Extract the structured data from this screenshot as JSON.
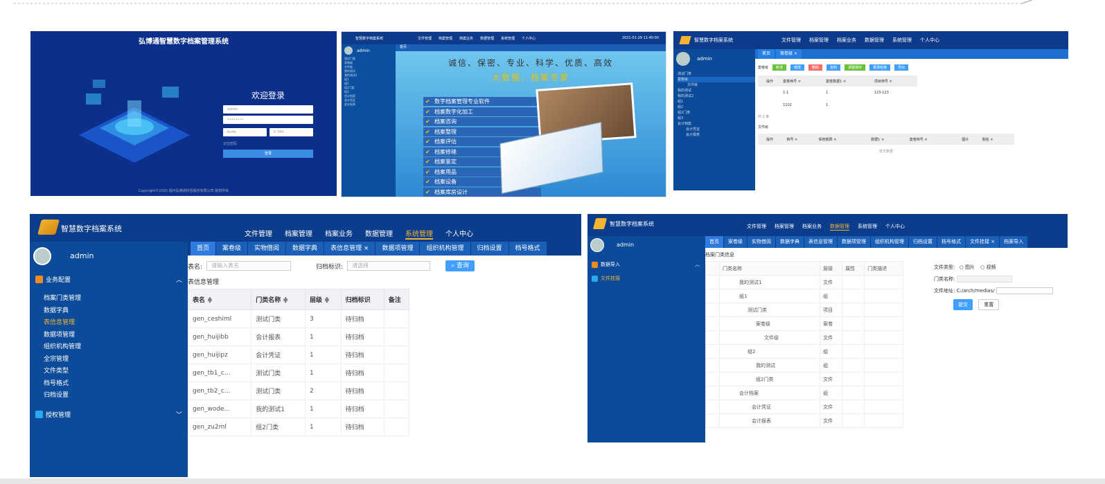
{
  "panel1": {
    "title": "弘博通智慧数字档案管理系统",
    "welcome": "欢迎登录",
    "username": "admin",
    "password": "••••••••",
    "captcha_input": "bx4e",
    "captcha_img": "6 ₰ϑ4",
    "remember": "记住密码",
    "login_button": "登录",
    "footer": "Copyright©2020 福州弘博通科技股份有限公司 版权所有"
  },
  "panel2": {
    "brand": "智慧数字档案系统",
    "nav": [
      "文件管理",
      "档案管理",
      "档案业务",
      "数据管理",
      "系统管理",
      "个人中心"
    ],
    "datetime": "2021-01-29 11:40:00",
    "user": "admin",
    "tab": "首页",
    "sidebar": [
      "测试门类",
      "案卷级",
      "文件级",
      "我的测试",
      "我的测试2",
      "组1",
      "组2",
      "组2门类",
      "组3",
      "会计档案",
      "会计凭证",
      "会计报表"
    ],
    "slogan1": "诚信、保密、专业、科学、优质、高效",
    "slogan2": "大数据、档案专家",
    "services": [
      "数字档案管理专业软件",
      "档案数字化加工",
      "档案咨询",
      "档案整理",
      "档案评估",
      "档案修裱",
      "档案鉴定",
      "档案用品",
      "档案设备",
      "档案库房设计"
    ]
  },
  "panel3": {
    "brand": "智慧数字档案系统",
    "nav": [
      "文件管理",
      "档案管理",
      "档案业务",
      "数据管理",
      "系统管理",
      "个人中心"
    ],
    "user": "admin",
    "tabs": [
      "首页",
      "案卷级 ×"
    ],
    "sidebar": [
      "测试门类",
      "案卷级",
      "文件级",
      "我的测试",
      "我的测试2",
      "组1",
      "组2",
      "组2门类",
      "组3",
      "会计档案",
      "会计凭证",
      "会计报表"
    ],
    "section1": "案卷级",
    "section2": "文件级",
    "buttons": [
      "新增",
      "修改",
      "删除",
      "复制",
      "调整顺序",
      "著录组卷",
      "导出"
    ],
    "table1_headers": [
      "操作",
      "案卷档号 ≑",
      "案卷数据1 ≑",
      "项目档号 ≑"
    ],
    "table1_rows": [
      [
        "",
        "1-1",
        "1",
        "123-123"
      ],
      [
        "",
        "1102",
        "1",
        ""
      ]
    ],
    "pager": "共 2 条",
    "table2_headers": [
      "操作",
      "档号 ≑",
      "保管期限 ≑",
      "数据1 ≑",
      "案卷档号 ≑",
      "图片",
      "题名 ≑"
    ],
    "empty": "暂无数据"
  },
  "panel4": {
    "brand": "智慧数字档案系统",
    "nav": [
      "文件管理",
      "档案管理",
      "档案业务",
      "数据管理",
      "系统管理",
      "个人中心"
    ],
    "active_nav": "系统管理",
    "user": "admin",
    "section1": "业务配置",
    "section2": "授权管理",
    "sub_items": [
      "档案门类管理",
      "数据字典",
      "表信息管理",
      "数据项管理",
      "组织机构管理",
      "全宗管理",
      "文件类型",
      "档号格式",
      "归档设置"
    ],
    "tabs": [
      "首页",
      "案卷级",
      "实物借阅",
      "数据字典",
      "表信息管理 ×",
      "数据项管理",
      "组织机构管理",
      "归档设置",
      "档号格式"
    ],
    "filter_label1": "表名:",
    "filter_ph1": "请输入表名",
    "filter_label2": "归档标识:",
    "filter_ph2": "请选择",
    "query_button": "查询",
    "section_title": "表信息管理",
    "headers": [
      "表名 ≑",
      "门类名称 ≑",
      "层级 ≑",
      "归档标识",
      "备注"
    ],
    "rows": [
      [
        "gen_ceshiml",
        "测试门类",
        "3",
        "待归档",
        ""
      ],
      [
        "gen_huijibb",
        "会计报表",
        "1",
        "待归档",
        ""
      ],
      [
        "gen_huijipz",
        "会计凭证",
        "1",
        "待归档",
        ""
      ],
      [
        "gen_tb1_c...",
        "测试门类",
        "1",
        "待归档",
        ""
      ],
      [
        "gen_tb2_c...",
        "测试门类",
        "2",
        "待归档",
        ""
      ],
      [
        "gen_wode...",
        "我的测试1",
        "1",
        "待归档",
        ""
      ],
      [
        "gen_zu2ml",
        "组2门类",
        "1",
        "待归档",
        ""
      ]
    ]
  },
  "panel5": {
    "brand": "智慧数字档案系统",
    "nav": [
      "文件管理",
      "档案管理",
      "档案业务",
      "数据管理",
      "系统管理",
      "个人中心"
    ],
    "user": "admin",
    "section1": "数据导入",
    "section1_item": "文件挂接",
    "tabs": [
      "首页",
      "案卷级",
      "实物借阅",
      "数据字典",
      "表信息管理",
      "数据项管理",
      "组织机构管理",
      "归档设置",
      "档号格式",
      "文件挂接 ×",
      "档案导入"
    ],
    "tree_title": "档案门类信息",
    "headers": [
      "门类名称",
      "层级",
      "属性",
      "门类描述"
    ],
    "rows": [
      [
        "我的测试1",
        "文件"
      ],
      [
        "组1",
        "组"
      ],
      [
        "测试门类",
        "项目"
      ],
      [
        "案卷级",
        "案卷"
      ],
      [
        "文件级",
        "文件"
      ],
      [
        "组2",
        "组"
      ],
      [
        "我的测试",
        "组"
      ],
      [
        "组2门类",
        "文件"
      ],
      [
        "会计档案",
        "组"
      ],
      [
        "会计凭证",
        "文件"
      ],
      [
        "会计报表",
        "文件"
      ]
    ],
    "form_type_label": "文件类型:",
    "form_type_options": [
      "图片",
      "视频"
    ],
    "form_name_label": "门类名称:",
    "form_path_label": "文件地址:",
    "form_path_value": "C:/arch/medias/",
    "submit": "提交",
    "reset": "重置"
  }
}
